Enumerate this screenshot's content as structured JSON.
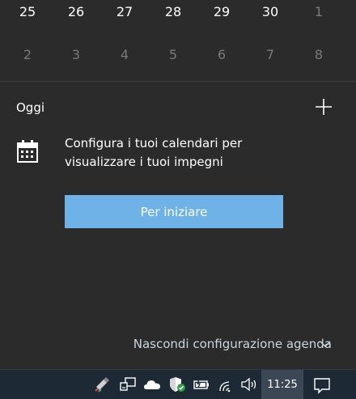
{
  "calendar": {
    "week1": [
      {
        "day": "25",
        "other": false
      },
      {
        "day": "26",
        "other": false
      },
      {
        "day": "27",
        "other": false
      },
      {
        "day": "28",
        "other": false
      },
      {
        "day": "29",
        "other": false
      },
      {
        "day": "30",
        "other": false
      },
      {
        "day": "1",
        "other": true
      }
    ],
    "week2": [
      "2",
      "3",
      "4",
      "5",
      "6",
      "7",
      "8"
    ]
  },
  "agenda": {
    "title": "Oggi",
    "message": "Configura i tuoi calendari per visualizzare i tuoi impegni",
    "start_button": "Per iniziare",
    "hide_link": "Nascondi configurazione agenda"
  },
  "taskbar": {
    "clock": "11:25",
    "tray_icons": [
      "usb-icon",
      "network-icon",
      "onedrive-cloud-icon",
      "security-shield-icon",
      "battery-icon",
      "wifi-icon",
      "volume-icon"
    ]
  },
  "colors": {
    "flyout_bg": "#2b2b2b",
    "accent_button": "#6fb2e8",
    "taskbar_bg": "#1d2a36",
    "muted_text": "#7a7a7a"
  }
}
